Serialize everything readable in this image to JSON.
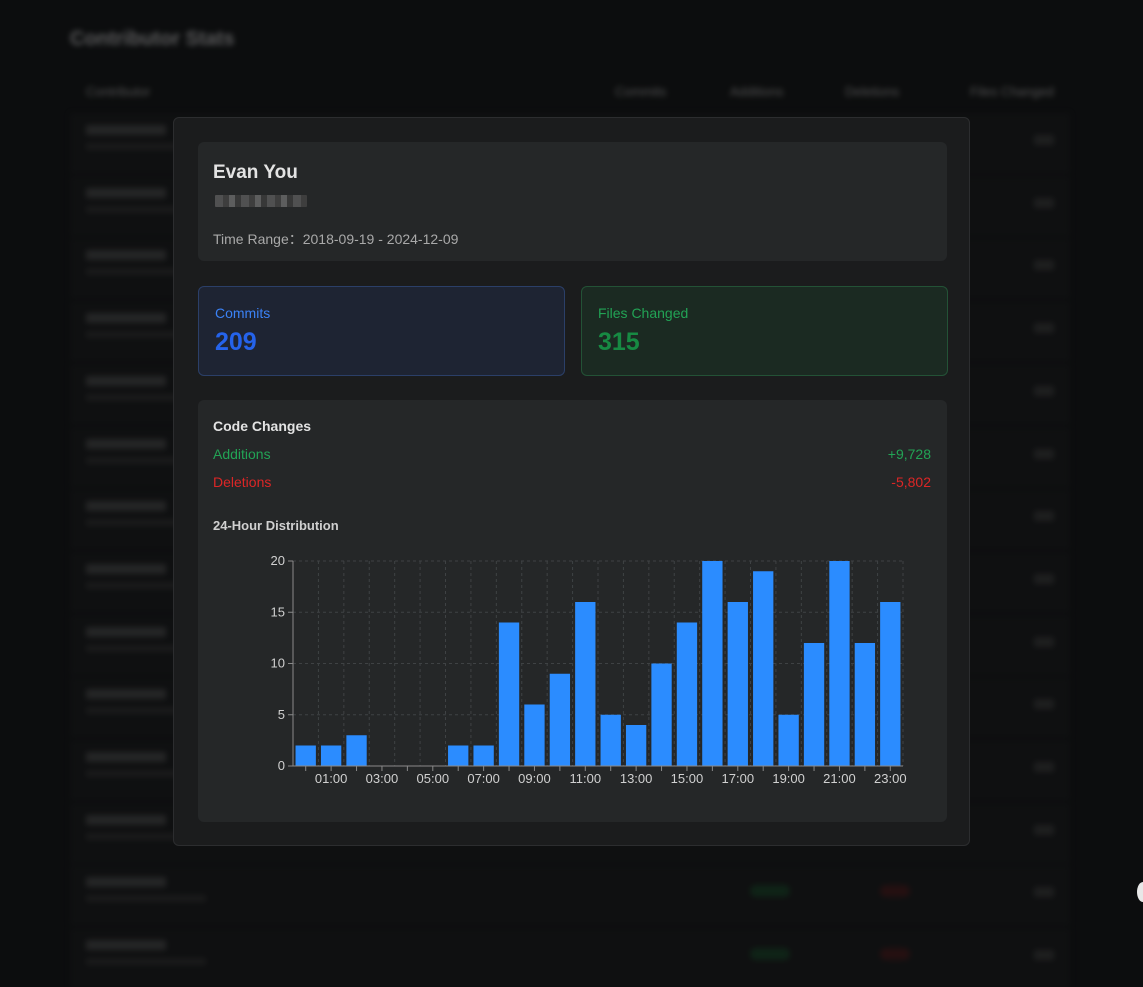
{
  "background": {
    "title": "Contributor Stats",
    "columns": [
      "Contributor",
      "Commits",
      "Additions",
      "Deletions",
      "Files Changed"
    ]
  },
  "profile": {
    "name": "Evan You",
    "time_range": "Time Range：2018-09-19 - 2024-12-09"
  },
  "stats": {
    "commits_label": "Commits",
    "commits_value": "209",
    "files_label": "Files Changed",
    "files_value": "315"
  },
  "code_changes": {
    "title": "Code Changes",
    "additions_label": "Additions",
    "additions_value": "+9,728",
    "deletions_label": "Deletions",
    "deletions_value": "-5,802"
  },
  "distribution_title": "24-Hour Distribution",
  "colors": {
    "bar": "#2b8cff",
    "additions": "#22a355",
    "deletions": "#dc2626"
  },
  "chart_data": {
    "type": "bar",
    "categories": [
      "00:00",
      "01:00",
      "02:00",
      "03:00",
      "04:00",
      "05:00",
      "06:00",
      "07:00",
      "08:00",
      "09:00",
      "10:00",
      "11:00",
      "12:00",
      "13:00",
      "14:00",
      "15:00",
      "16:00",
      "17:00",
      "18:00",
      "19:00",
      "20:00",
      "21:00",
      "22:00",
      "23:00"
    ],
    "tick_labels": [
      "01:00",
      "03:00",
      "05:00",
      "07:00",
      "09:00",
      "11:00",
      "13:00",
      "15:00",
      "17:00",
      "19:00",
      "21:00",
      "23:00"
    ],
    "values": [
      2,
      2,
      3,
      0,
      0,
      0,
      2,
      2,
      14,
      6,
      9,
      16,
      5,
      4,
      10,
      14,
      20,
      16,
      19,
      5,
      12,
      20,
      12,
      16
    ],
    "y_ticks": [
      0,
      5,
      10,
      15,
      20
    ],
    "ylim": [
      0,
      20
    ],
    "grid": true,
    "title": "24-Hour Distribution"
  }
}
